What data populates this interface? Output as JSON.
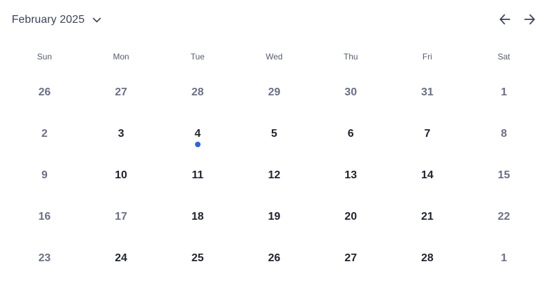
{
  "header": {
    "month_label": "February 2025",
    "dropdown_icon": "chevron-down-icon",
    "prev_icon": "arrow-left-icon",
    "next_icon": "arrow-right-icon"
  },
  "weekdays": [
    "Sun",
    "Mon",
    "Tue",
    "Wed",
    "Thu",
    "Fri",
    "Sat"
  ],
  "weeks": [
    [
      {
        "day": "26",
        "muted": true
      },
      {
        "day": "27",
        "muted": true
      },
      {
        "day": "28",
        "muted": true
      },
      {
        "day": "29",
        "muted": true
      },
      {
        "day": "30",
        "muted": true
      },
      {
        "day": "31",
        "muted": true
      },
      {
        "day": "1",
        "muted": true
      }
    ],
    [
      {
        "day": "2",
        "muted": true
      },
      {
        "day": "3",
        "muted": false
      },
      {
        "day": "4",
        "muted": false,
        "event": true
      },
      {
        "day": "5",
        "muted": false
      },
      {
        "day": "6",
        "muted": false
      },
      {
        "day": "7",
        "muted": false
      },
      {
        "day": "8",
        "muted": true
      }
    ],
    [
      {
        "day": "9",
        "muted": true
      },
      {
        "day": "10",
        "muted": false
      },
      {
        "day": "11",
        "muted": false
      },
      {
        "day": "12",
        "muted": false
      },
      {
        "day": "13",
        "muted": false
      },
      {
        "day": "14",
        "muted": false
      },
      {
        "day": "15",
        "muted": true
      }
    ],
    [
      {
        "day": "16",
        "muted": true
      },
      {
        "day": "17",
        "muted": true
      },
      {
        "day": "18",
        "muted": false
      },
      {
        "day": "19",
        "muted": false
      },
      {
        "day": "20",
        "muted": false
      },
      {
        "day": "21",
        "muted": false
      },
      {
        "day": "22",
        "muted": true
      }
    ],
    [
      {
        "day": "23",
        "muted": true
      },
      {
        "day": "24",
        "muted": false
      },
      {
        "day": "25",
        "muted": false
      },
      {
        "day": "26",
        "muted": false
      },
      {
        "day": "27",
        "muted": false
      },
      {
        "day": "28",
        "muted": false
      },
      {
        "day": "1",
        "muted": true
      }
    ]
  ],
  "colors": {
    "event_dot": "#2f64e0",
    "muted_text": "#6b6f85",
    "current_text": "#21242f"
  }
}
